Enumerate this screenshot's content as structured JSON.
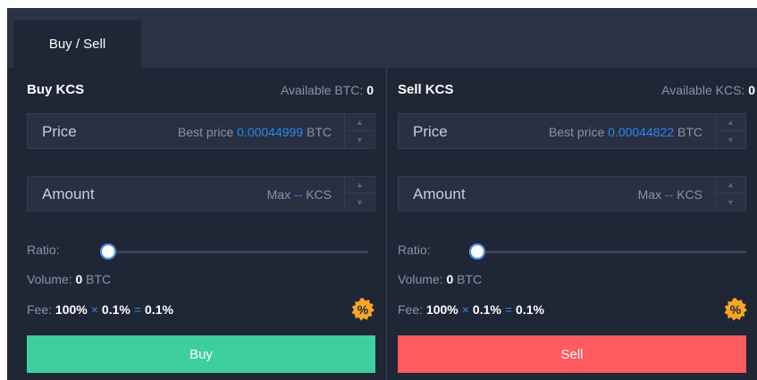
{
  "tabs": [
    {
      "label": "Buy / Sell"
    }
  ],
  "buy": {
    "title": "Buy KCS",
    "available_label": "Available BTC:",
    "available_value": "0",
    "price": {
      "label": "Price",
      "hint_prefix": "Best price",
      "best_price": "0.00044999",
      "unit": "BTC"
    },
    "amount": {
      "label": "Amount",
      "max_label": "Max",
      "max_value": "--",
      "unit": "KCS"
    },
    "ratio_label": "Ratio:",
    "ratio_value": 0,
    "volume_label": "Volume:",
    "volume_value": "0",
    "volume_unit": "BTC",
    "fee_label": "Fee:",
    "fee_a": "100%",
    "fee_op1": "×",
    "fee_b": "0.1%",
    "fee_op2": "=",
    "fee_result": "0.1%",
    "badge": "%",
    "button": "Buy"
  },
  "sell": {
    "title": "Sell KCS",
    "available_label": "Available KCS:",
    "available_value": "0",
    "price": {
      "label": "Price",
      "hint_prefix": "Best price",
      "best_price": "0.00044822",
      "unit": "BTC"
    },
    "amount": {
      "label": "Amount",
      "max_label": "Max",
      "max_value": "--",
      "unit": "KCS"
    },
    "ratio_label": "Ratio:",
    "ratio_value": 0,
    "volume_label": "Volume:",
    "volume_value": "0",
    "volume_unit": "BTC",
    "fee_label": "Fee:",
    "fee_a": "100%",
    "fee_op1": "×",
    "fee_b": "0.1%",
    "fee_op2": "=",
    "fee_result": "0.1%",
    "badge": "%",
    "button": "Sell"
  },
  "icons": {
    "up": "chevron-up-icon",
    "down": "chevron-down-icon",
    "badge": "discount-badge-icon"
  },
  "colors": {
    "background": "#1f2635",
    "tabbar": "#2b3243",
    "accent_blue": "#2d86ee",
    "buy": "#3fcf9f",
    "sell": "#ff5a5f",
    "badge": "#f5a623"
  }
}
